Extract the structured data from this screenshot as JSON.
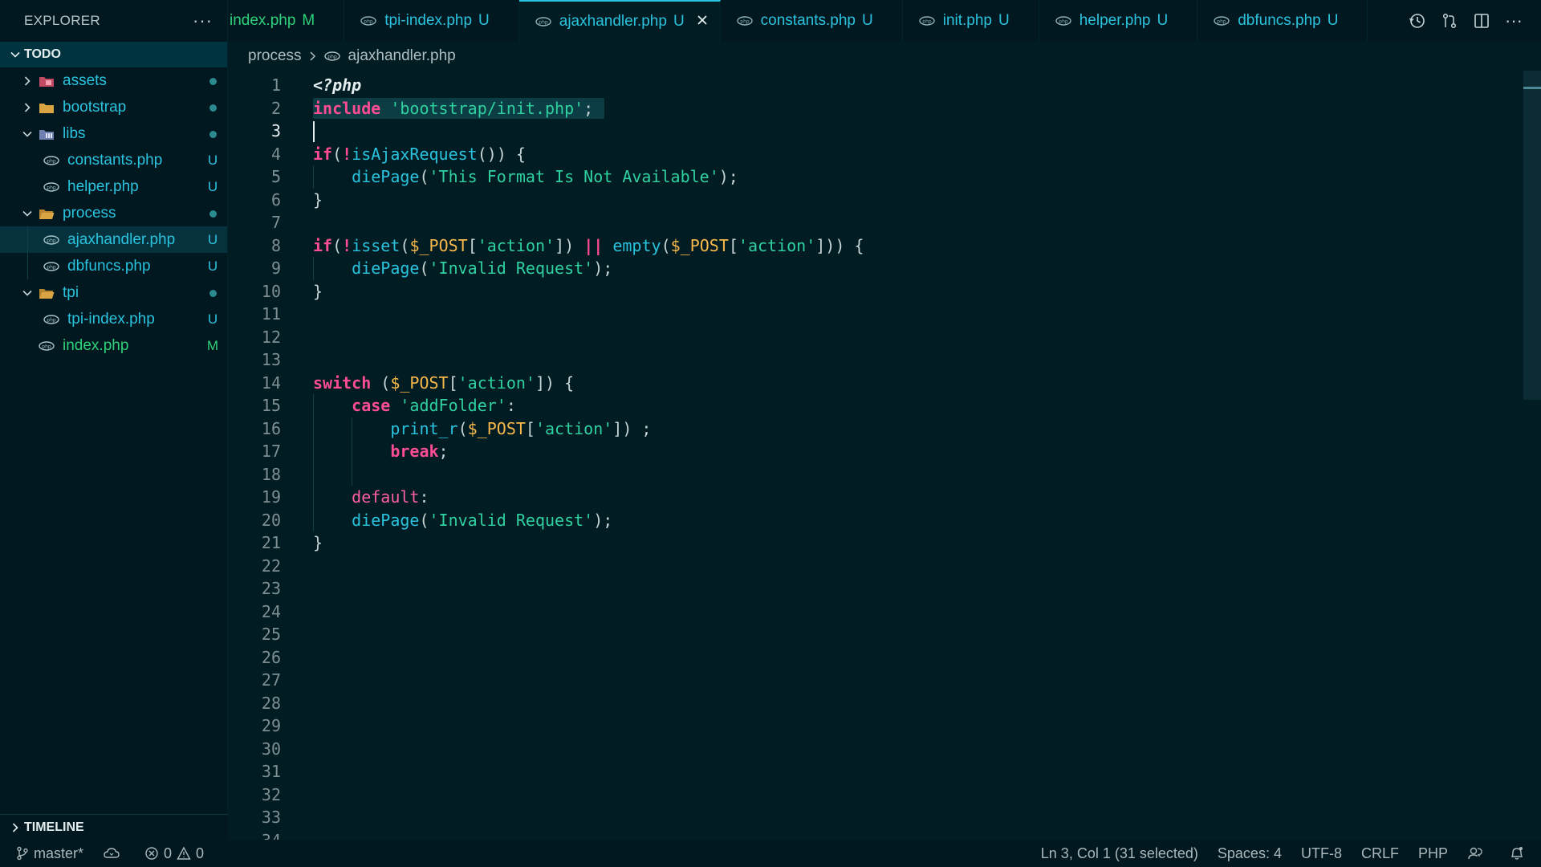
{
  "explorer": {
    "title": "EXPLORER",
    "workspace": "TODO",
    "tree": [
      {
        "label": "assets",
        "type": "folder",
        "depth": 0,
        "expanded": false,
        "badge": "dot",
        "icon": "folder-assets-icon"
      },
      {
        "label": "bootstrap",
        "type": "folder",
        "depth": 0,
        "expanded": false,
        "badge": "dot",
        "icon": "folder-icon"
      },
      {
        "label": "libs",
        "type": "folder",
        "depth": 0,
        "expanded": true,
        "badge": "dot",
        "icon": "folder-libs-icon"
      },
      {
        "label": "constants.php",
        "type": "file",
        "depth": 1,
        "badge": "U",
        "icon": "php-file-icon"
      },
      {
        "label": "helper.php",
        "type": "file",
        "depth": 1,
        "badge": "U",
        "icon": "php-file-icon"
      },
      {
        "label": "process",
        "type": "folder",
        "depth": 0,
        "expanded": true,
        "badge": "dot",
        "icon": "folder-open-icon"
      },
      {
        "label": "ajaxhandler.php",
        "type": "file",
        "depth": 1,
        "badge": "U",
        "icon": "php-file-icon",
        "selected": true
      },
      {
        "label": "dbfuncs.php",
        "type": "file",
        "depth": 1,
        "badge": "U",
        "icon": "php-file-icon"
      },
      {
        "label": "tpi",
        "type": "folder",
        "depth": 0,
        "expanded": true,
        "badge": "dot",
        "icon": "folder-open-icon"
      },
      {
        "label": "tpi-index.php",
        "type": "file",
        "depth": 1,
        "badge": "U",
        "icon": "php-file-icon"
      },
      {
        "label": "index.php",
        "type": "file",
        "depth": 0,
        "badge": "M",
        "icon": "php-file-icon",
        "modified": true
      }
    ],
    "timeline": "TIMELINE"
  },
  "tabs": [
    {
      "label": "index.php",
      "badge": "M",
      "modified": true,
      "icon": false
    },
    {
      "label": "tpi-index.php",
      "badge": "U"
    },
    {
      "label": "ajaxhandler.php",
      "badge": "U",
      "active": true
    },
    {
      "label": "constants.php",
      "badge": "U"
    },
    {
      "label": "init.php",
      "badge": "U"
    },
    {
      "label": "helper.php",
      "badge": "U"
    },
    {
      "label": "dbfuncs.php",
      "badge": "U"
    }
  ],
  "breadcrumb": {
    "folder": "process",
    "file": "ajaxhandler.php"
  },
  "editor": {
    "line_count": 34,
    "current_line": 3,
    "lines": [
      [
        [
          "php-tag",
          "<?php"
        ]
      ],
      [
        [
          "k",
          "include"
        ],
        [
          "p",
          " "
        ],
        [
          "s",
          "'bootstrap/init.php'"
        ],
        [
          "p",
          ";"
        ]
      ],
      [],
      [
        [
          "k",
          "if"
        ],
        [
          "p",
          "("
        ],
        [
          "k",
          "!"
        ],
        [
          "fn",
          "isAjaxRequest"
        ],
        [
          "p",
          "()) {"
        ]
      ],
      [
        [
          "p",
          "    "
        ],
        [
          "fn",
          "diePage"
        ],
        [
          "p",
          "("
        ],
        [
          "s",
          "'This Format Is Not Available'"
        ],
        [
          "p",
          ");"
        ]
      ],
      [
        [
          "p",
          "}"
        ]
      ],
      [],
      [
        [
          "k",
          "if"
        ],
        [
          "p",
          "("
        ],
        [
          "k",
          "!"
        ],
        [
          "fn",
          "isset"
        ],
        [
          "p",
          "("
        ],
        [
          "v",
          "$_POST"
        ],
        [
          "p",
          "["
        ],
        [
          "s",
          "'action'"
        ],
        [
          "p",
          "]) "
        ],
        [
          "k",
          "||"
        ],
        [
          "p",
          " "
        ],
        [
          "fn",
          "empty"
        ],
        [
          "p",
          "("
        ],
        [
          "v",
          "$_POST"
        ],
        [
          "p",
          "["
        ],
        [
          "s",
          "'action'"
        ],
        [
          "p",
          "])) {"
        ]
      ],
      [
        [
          "p",
          "    "
        ],
        [
          "fn",
          "diePage"
        ],
        [
          "p",
          "("
        ],
        [
          "s",
          "'Invalid Request'"
        ],
        [
          "p",
          ");"
        ]
      ],
      [
        [
          "p",
          "}"
        ]
      ],
      [],
      [],
      [],
      [
        [
          "k",
          "switch"
        ],
        [
          "p",
          " ("
        ],
        [
          "v",
          "$_POST"
        ],
        [
          "p",
          "["
        ],
        [
          "s",
          "'action'"
        ],
        [
          "p",
          "]) {"
        ]
      ],
      [
        [
          "p",
          "    "
        ],
        [
          "k",
          "case"
        ],
        [
          "p",
          " "
        ],
        [
          "s",
          "'addFolder'"
        ],
        [
          "p",
          ":"
        ]
      ],
      [
        [
          "p",
          "        "
        ],
        [
          "fn",
          "print_r"
        ],
        [
          "p",
          "("
        ],
        [
          "v",
          "$_POST"
        ],
        [
          "p",
          "["
        ],
        [
          "s",
          "'action'"
        ],
        [
          "p",
          "]) ;"
        ]
      ],
      [
        [
          "p",
          "        "
        ],
        [
          "k",
          "break"
        ],
        [
          "p",
          ";"
        ]
      ],
      [],
      [
        [
          "p",
          "    "
        ],
        [
          "kd",
          "default"
        ],
        [
          "p",
          ":"
        ]
      ],
      [
        [
          "p",
          "    "
        ],
        [
          "fn",
          "diePage"
        ],
        [
          "p",
          "("
        ],
        [
          "s",
          "'Invalid Request'"
        ],
        [
          "p",
          ");"
        ]
      ],
      [
        [
          "p",
          "}"
        ]
      ]
    ]
  },
  "status": {
    "branch": "master*",
    "errors": "0",
    "warnings": "0",
    "position": "Ln 3, Col 1 (31 selected)",
    "spaces": "Spaces: 4",
    "encoding": "UTF-8",
    "eol": "CRLF",
    "language": "PHP"
  },
  "colors": {
    "accent": "#2ac3de",
    "modified": "#2fd17a",
    "background": "#011c22"
  }
}
